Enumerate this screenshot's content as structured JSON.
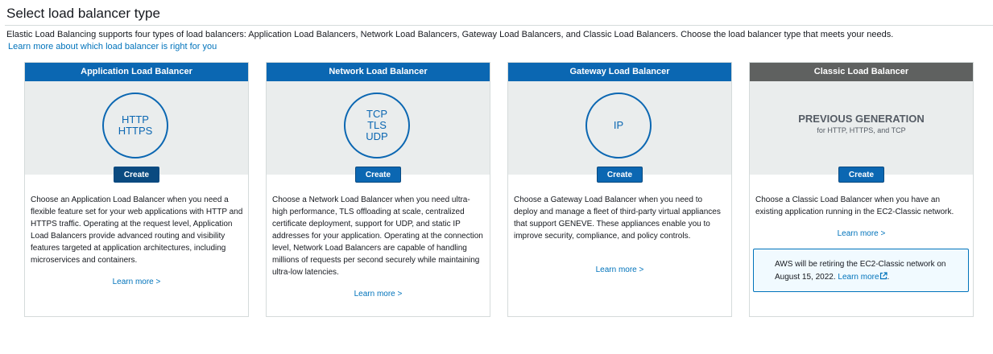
{
  "header": {
    "title": "Select load balancer type",
    "description": "Elastic Load Balancing supports four types of load balancers: Application Load Balancers, Network Load Balancers, Gateway Load Balancers, and Classic Load Balancers. Choose the load balancer type that meets your needs.",
    "learn_link": "Learn more about which load balancer is right for you"
  },
  "colors": {
    "primary_blue": "#0b67b2",
    "link_blue": "#0073bb",
    "legacy_header": "#5f6160",
    "visual_bg": "#eaeded",
    "notice_bg": "#f1faff"
  },
  "cards": [
    {
      "header": "Application Load Balancer",
      "protocols": [
        "HTTP",
        "HTTPS"
      ],
      "create_label": "Create",
      "description": "Choose an Application Load Balancer when you need a flexible feature set for your web applications with HTTP and HTTPS traffic. Operating at the request level, Application Load Balancers provide advanced routing and visibility features targeted at application architectures, including microservices and containers.",
      "learn_more": "Learn more >"
    },
    {
      "header": "Network Load Balancer",
      "protocols": [
        "TCP",
        "TLS",
        "UDP"
      ],
      "create_label": "Create",
      "description": "Choose a Network Load Balancer when you need ultra-high performance, TLS offloading at scale, centralized certificate deployment, support for UDP, and static IP addresses for your application. Operating at the connection level, Network Load Balancers are capable of handling millions of requests per second securely while maintaining ultra-low latencies.",
      "learn_more": "Learn more >"
    },
    {
      "header": "Gateway Load Balancer",
      "protocols": [
        "IP"
      ],
      "create_label": "Create",
      "description": "Choose a Gateway Load Balancer when you need to deploy and manage a fleet of third-party virtual appliances that support GENEVE. These appliances enable you to improve security, compliance, and policy controls.",
      "learn_more": "Learn more >"
    },
    {
      "header": "Classic Load Balancer",
      "previous_generation": "PREVIOUS GENERATION",
      "previous_generation_sub": "for HTTP, HTTPS, and TCP",
      "create_label": "Create",
      "description": "Choose a Classic Load Balancer when you have an existing application running in the EC2-Classic network.",
      "learn_more": "Learn more >",
      "notice": {
        "text": "AWS will be retiring the EC2-Classic network on August 15, 2022.",
        "link": "Learn more",
        "link_icon": "external-link-icon",
        "suffix": "."
      }
    }
  ]
}
